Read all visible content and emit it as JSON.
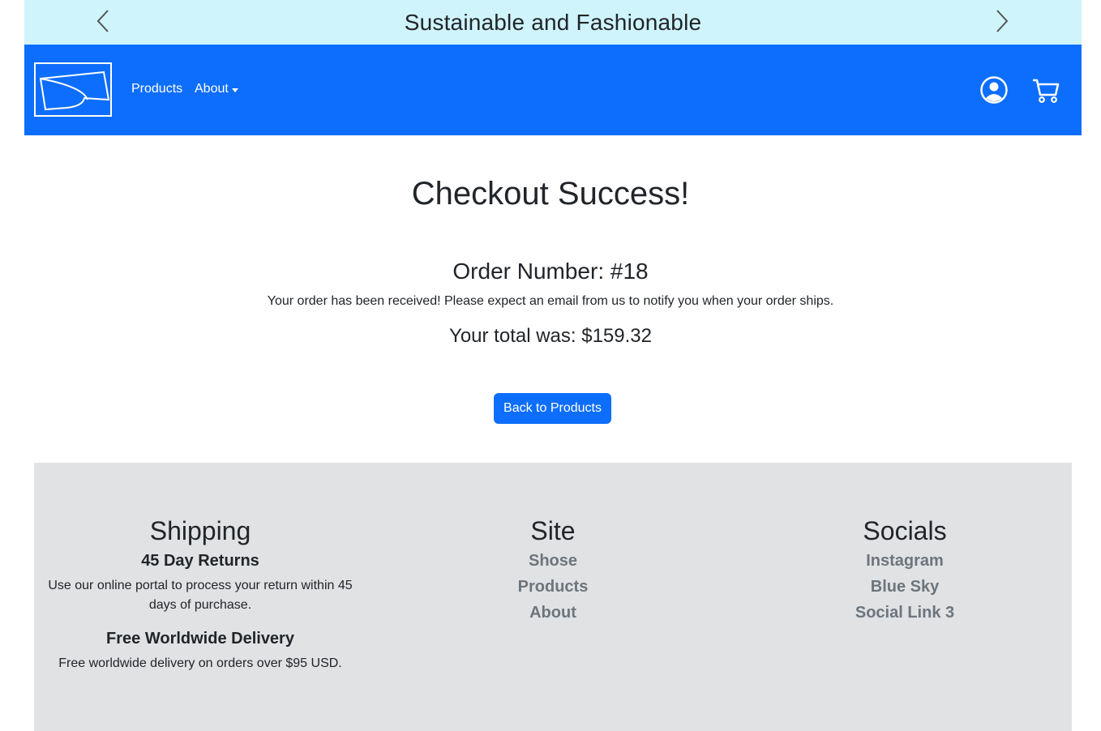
{
  "promo": {
    "text": "Sustainable and Fashionable",
    "prev_icon": "chevron-left-icon",
    "next_icon": "chevron-right-icon"
  },
  "navbar": {
    "logo": "brand-logo",
    "links": {
      "products": "Products",
      "about": "About"
    },
    "icons": [
      "account-icon",
      "cart-icon"
    ]
  },
  "main": {
    "title": "Checkout Success!",
    "order_number": "Order Number: #18",
    "message": "Your order has been received! Please expect an email from us to notify you when your order ships.",
    "total": "Your total was: $159.32",
    "back_button": "Back to Products"
  },
  "footer": {
    "shipping": {
      "heading": "Shipping",
      "returns_title": "45 Day Returns",
      "returns_text": "Use our online portal to process your return within 45 days of purchase.",
      "delivery_title": "Free Worldwide Delivery",
      "delivery_text": "Free worldwide delivery on orders over $95 USD."
    },
    "site": {
      "heading": "Site",
      "links": [
        "Shose",
        "Products",
        "About"
      ]
    },
    "socials": {
      "heading": "Socials",
      "links": [
        "Instagram",
        "Blue Sky",
        "Social Link 3"
      ]
    }
  },
  "colors": {
    "promo_bg": "#cff4fc",
    "primary": "#0d6efd",
    "footer_bg": "#e1e2e4",
    "link_gray": "#6c757d"
  }
}
